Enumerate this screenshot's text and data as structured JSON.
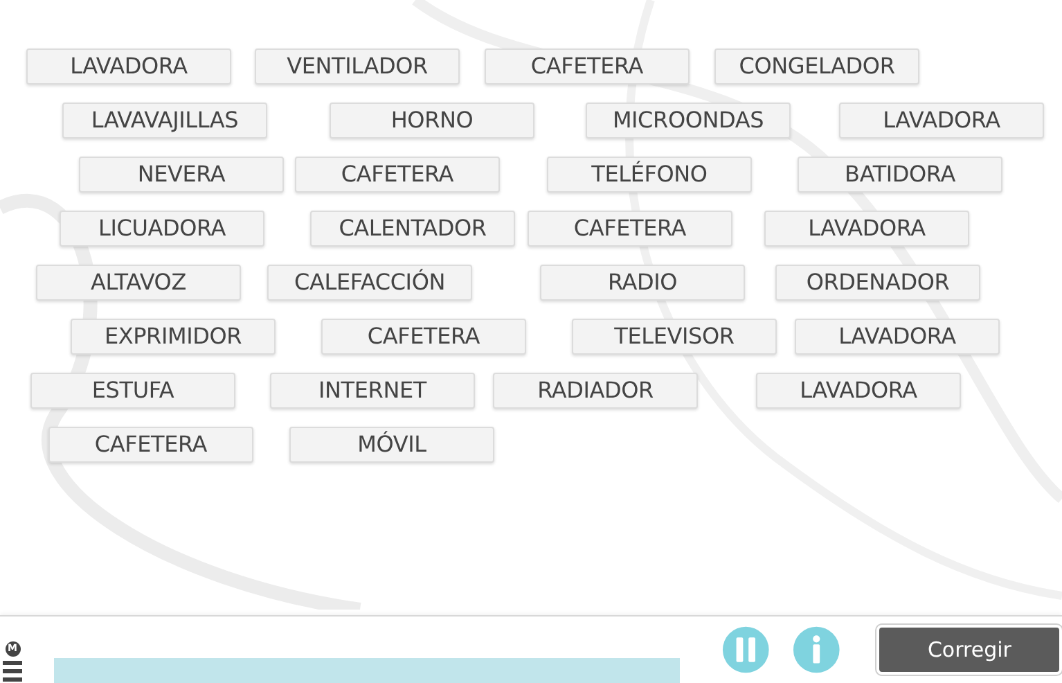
{
  "word_rows": [
    [
      "LAVADORA",
      "VENTILADOR",
      "CAFETERA",
      "CONGELADOR"
    ],
    [
      "LAVAVAJILLAS",
      "HORNO",
      "MICROONDAS",
      "LAVADORA"
    ],
    [
      "NEVERA",
      "CAFETERA",
      "TELÉFONO",
      "BATIDORA"
    ],
    [
      "LICUADORA",
      "CALENTADOR",
      "CAFETERA",
      "LAVADORA"
    ],
    [
      "ALTAVOZ",
      "CALEFACCIÓN",
      "RADIO",
      "ORDENADOR"
    ],
    [
      "EXPRIMIDOR",
      "CAFETERA",
      "TELEVISOR",
      "LAVADORA"
    ],
    [
      "ESTUFA",
      "INTERNET",
      "RADIADOR",
      "LAVADORA"
    ],
    [
      "CAFETERA",
      "MÓVIL"
    ]
  ],
  "bottom_bar": {
    "menu_badge": "M",
    "check_button": "Corregir"
  }
}
